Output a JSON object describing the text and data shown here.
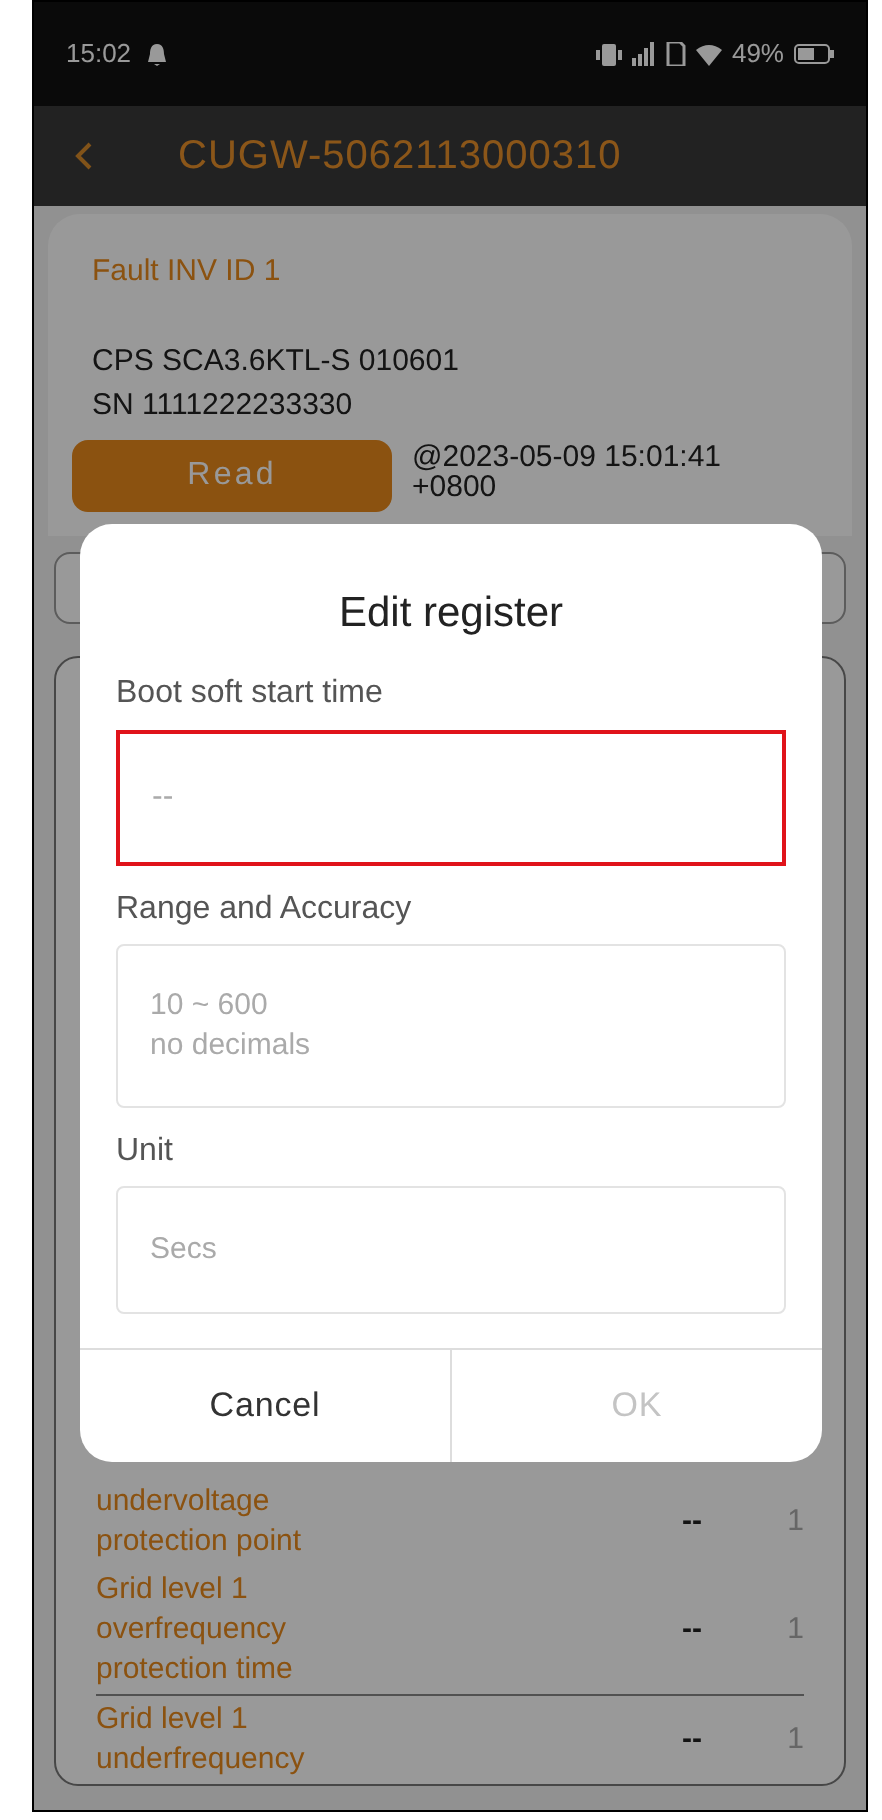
{
  "status_bar": {
    "time": "15:02",
    "battery": "49%"
  },
  "header": {
    "title": "CUGW-5062113000310"
  },
  "device": {
    "fault": "Fault INV ID 1",
    "model": "CPS SCA3.6KTL-S 010601",
    "serial": "SN 1111222233330",
    "read_button": "Read",
    "timestamp": "@2023-05-09 15:01:41",
    "timezone": "+0800"
  },
  "registers": [
    {
      "name": "undervoltage protection point",
      "value": "--",
      "column_3": "1"
    },
    {
      "name": "Grid level 1 overfrequency protection time",
      "value": "--",
      "column_3": "1"
    },
    {
      "name": "Grid level 1 underfrequency",
      "value": "--",
      "column_3": "1"
    }
  ],
  "dialog": {
    "title": "Edit register",
    "fields": [
      {
        "kind": "input",
        "label": "Boot soft start time",
        "placeholder": "--",
        "focused": true
      },
      {
        "kind": "readonly",
        "label": "Range and Accuracy",
        "lines": [
          "10 ~ 600",
          "no decimals"
        ]
      },
      {
        "kind": "readonly",
        "label": "Unit",
        "lines": [
          "Secs"
        ]
      }
    ],
    "buttons": [
      {
        "label": "Cancel",
        "disabled": false
      },
      {
        "label": "OK",
        "disabled": true
      }
    ]
  }
}
